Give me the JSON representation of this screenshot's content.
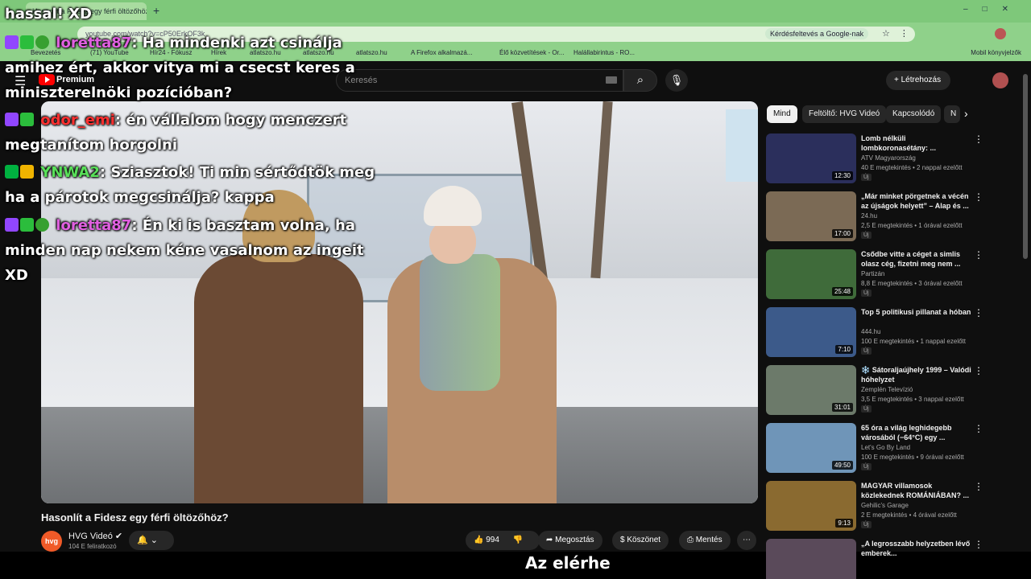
{
  "browser": {
    "tab_title": "Hasonlít a Fidesz egy férfi öltözőhöz?",
    "url": "youtube.com/watch?v=cP50ErkOF3k",
    "google_lens": "Kérdésfeltevés a Google-nak",
    "bookmarks": [
      "Bevezetés",
      "(71) YouTube",
      "Hír24 - Fókusz",
      "Hírek",
      "atlatszo.hu",
      "atlatszo.hu",
      "atlatszo.hu",
      "A Firefox alkalmazá...",
      "Élő közvetítések - Or...",
      "Halállabirintus - RO..."
    ],
    "bookmarks_extra": "Mobil könyvjelzők"
  },
  "youtube": {
    "logo_text": "Premium",
    "search_placeholder": "Keresés",
    "create_label": "Létrehozás"
  },
  "chat": [
    {
      "user": "",
      "message": "hassal! XD"
    },
    {
      "user": "loretta87",
      "message": ": Ha mindenki azt csinálja amihez ért, akkor vitya mi a csecst keres a miniszterelnöki pozícióban?"
    },
    {
      "user": "odor_emi",
      "message": ": én vállalom hogy menczert megtanítom horgolni"
    },
    {
      "user": "YNWA2",
      "message": ": Sziasztok! Ti min sértődtök meg ha a párotok megcsinálja? kappa"
    },
    {
      "user": "loretta87",
      "message": ": Én ki is basztam volna, ha minden nap nekem kéne vasalnom az ingeit XD"
    }
  ],
  "video": {
    "title": "Hasonlít a Fidesz egy férfi öltözőhöz?",
    "channel_name": "HVG Videó",
    "channel_avatar_text": "hvg",
    "subscribers": "104 E feliratkozó",
    "likes": "994",
    "share_label": "Megosztás",
    "thanks_label": "Köszönet",
    "save_label": "Mentés",
    "caption": "Az elérhe"
  },
  "chips": [
    "Mind",
    "Feltöltő: HVG Videó",
    "Kapcsolódó",
    "N"
  ],
  "recommendations": [
    {
      "title": "Lomb nélküli lombkoronasétány: ...",
      "channel": "ATV Magyarország",
      "meta": "40 E megtekintés • 2 nappal ezelőtt",
      "duration": "12:30",
      "new": "Új",
      "thumb_color": "#2b2f5c"
    },
    {
      "title": "„Már minket pörgetnek a vécén az újságok helyett” – Alap és ...",
      "channel": "24.hu",
      "meta": "2,5 E megtekintés • 1 órával ezelőtt",
      "duration": "17:00",
      "new": "Új",
      "thumb_color": "#7b6a55"
    },
    {
      "title": "Csődbe vitte a céget a simlis olasz cég, fizetni meg nem ...",
      "channel": "Partizán",
      "meta": "8,8 E megtekintés • 3 órával ezelőtt",
      "duration": "25:48",
      "new": "Új",
      "thumb_color": "#3f6b3a"
    },
    {
      "title": "Top 5 politikusi pillanat a hóban",
      "channel": "444.hu",
      "meta": "100 E megtekintés • 1 nappal ezelőtt",
      "duration": "7:10",
      "new": "Új",
      "thumb_color": "#3c5a8a"
    },
    {
      "title": "❄️ Sátoraljaújhely 1999 – Valódi hóhelyzet",
      "channel": "Zemplén Televízió",
      "meta": "3,5 E megtekintés • 3 nappal ezelőtt",
      "duration": "31:01",
      "new": "Új",
      "thumb_color": "#6c7a6a"
    },
    {
      "title": "65 óra a világ leghidegebb városából (−64°C) egy ...",
      "channel": "Let's Go By Land",
      "meta": "100 E megtekintés • 9 órával ezelőtt",
      "duration": "49:50",
      "new": "Új",
      "thumb_color": "#6f95b8"
    },
    {
      "title": "MAGYAR villamosok közlekednek ROMÁNIÁBAN? ...",
      "channel": "Gehilic's Garage",
      "meta": "2 E megtekintés • 4 órával ezelőtt",
      "duration": "9:13",
      "new": "Új",
      "thumb_color": "#8a6a30"
    },
    {
      "title": "„A legrosszabb helyzetben lévő emberek...",
      "channel": "",
      "meta": "",
      "duration": "",
      "new": "",
      "thumb_color": "#5a4a5a"
    }
  ]
}
